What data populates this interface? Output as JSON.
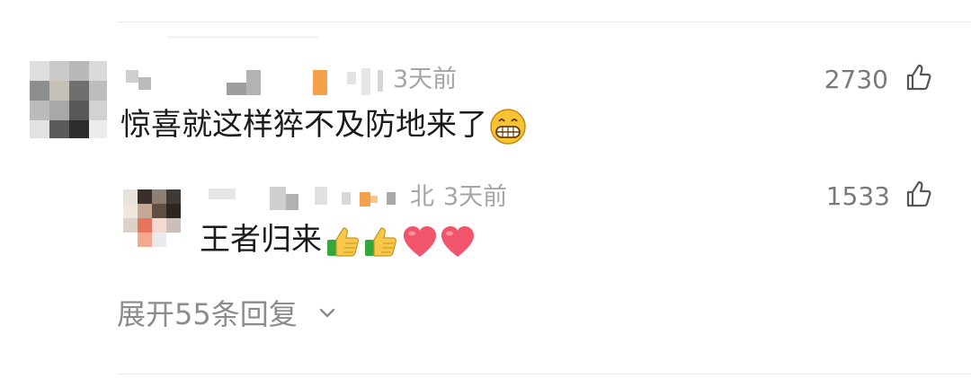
{
  "comment": {
    "time": "3天前",
    "likes": "2730",
    "text": "惊喜就这样猝不及防地来了",
    "emoji": "grinning-face-emoji",
    "reply": {
      "location_partial": "北",
      "time": "3天前",
      "likes": "1533",
      "text": "王者归来",
      "emojis": [
        "thumbs-up-emoji",
        "thumbs-up-emoji",
        "heart-emoji",
        "heart-emoji"
      ]
    }
  },
  "expand_label": "展开55条回复",
  "colors": {
    "accent_orange": "#f5a04a",
    "heart": "#f2546b",
    "meta": "#a5a5a5"
  }
}
